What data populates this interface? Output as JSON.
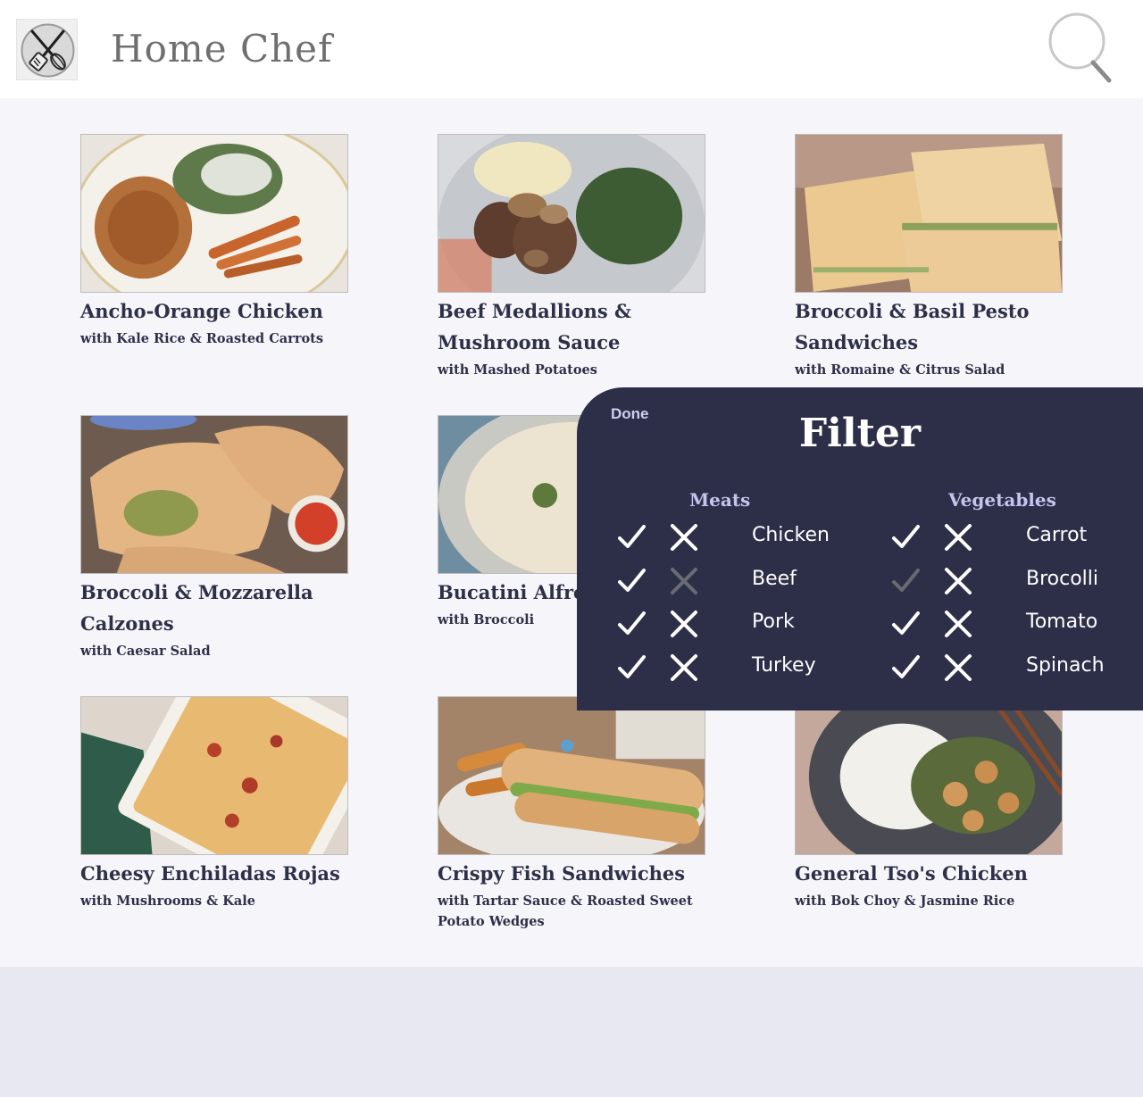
{
  "header": {
    "title": "Home Chef",
    "logo_icon": "whisk-spatula-icon",
    "search_icon": "magnifier-icon"
  },
  "recipes": [
    {
      "title": "Ancho-Orange Chicken",
      "subtitle": "with Kale Rice & Roasted Carrots"
    },
    {
      "title": "Beef Medallions & Mushroom Sauce",
      "subtitle": "with Mashed Potatoes"
    },
    {
      "title": "Broccoli & Basil Pesto Sandwiches",
      "subtitle": "with Romaine & Citrus Salad"
    },
    {
      "title": "Broccoli & Mozzarella Calzones",
      "subtitle": "with Caesar Salad"
    },
    {
      "title": "Bucatini Alfredo",
      "subtitle": "with Broccoli"
    },
    {
      "title": "",
      "subtitle": ""
    },
    {
      "title": "Cheesy Enchiladas Rojas",
      "subtitle": "with Mushrooms & Kale"
    },
    {
      "title": "Crispy Fish Sandwiches",
      "subtitle": "with Tartar Sauce & Roasted Sweet Potato Wedges"
    },
    {
      "title": "General Tso's Chicken",
      "subtitle": "with Bok Choy & Jasmine Rice"
    }
  ],
  "filter": {
    "done_label": "Done",
    "title": "Filter",
    "meats": {
      "heading": "Meats",
      "items": [
        {
          "label": "Chicken",
          "include": true,
          "exclude": true
        },
        {
          "label": "Beef",
          "include": true,
          "exclude": false
        },
        {
          "label": "Pork",
          "include": true,
          "exclude": true
        },
        {
          "label": "Turkey",
          "include": true,
          "exclude": true
        }
      ]
    },
    "vegetables": {
      "heading": "Vegetables",
      "items": [
        {
          "label": "Carrot",
          "include": true,
          "exclude": true
        },
        {
          "label": "Brocolli",
          "include": false,
          "exclude": true
        },
        {
          "label": "Tomato",
          "include": true,
          "exclude": true
        },
        {
          "label": "Spinach",
          "include": true,
          "exclude": true
        }
      ]
    }
  },
  "colors": {
    "panel": "#2d2f48",
    "accent": "#c4c5ee",
    "text_dark": "#2e2f48",
    "icon_on": "#ffffff",
    "icon_off": "#6a6a72"
  }
}
